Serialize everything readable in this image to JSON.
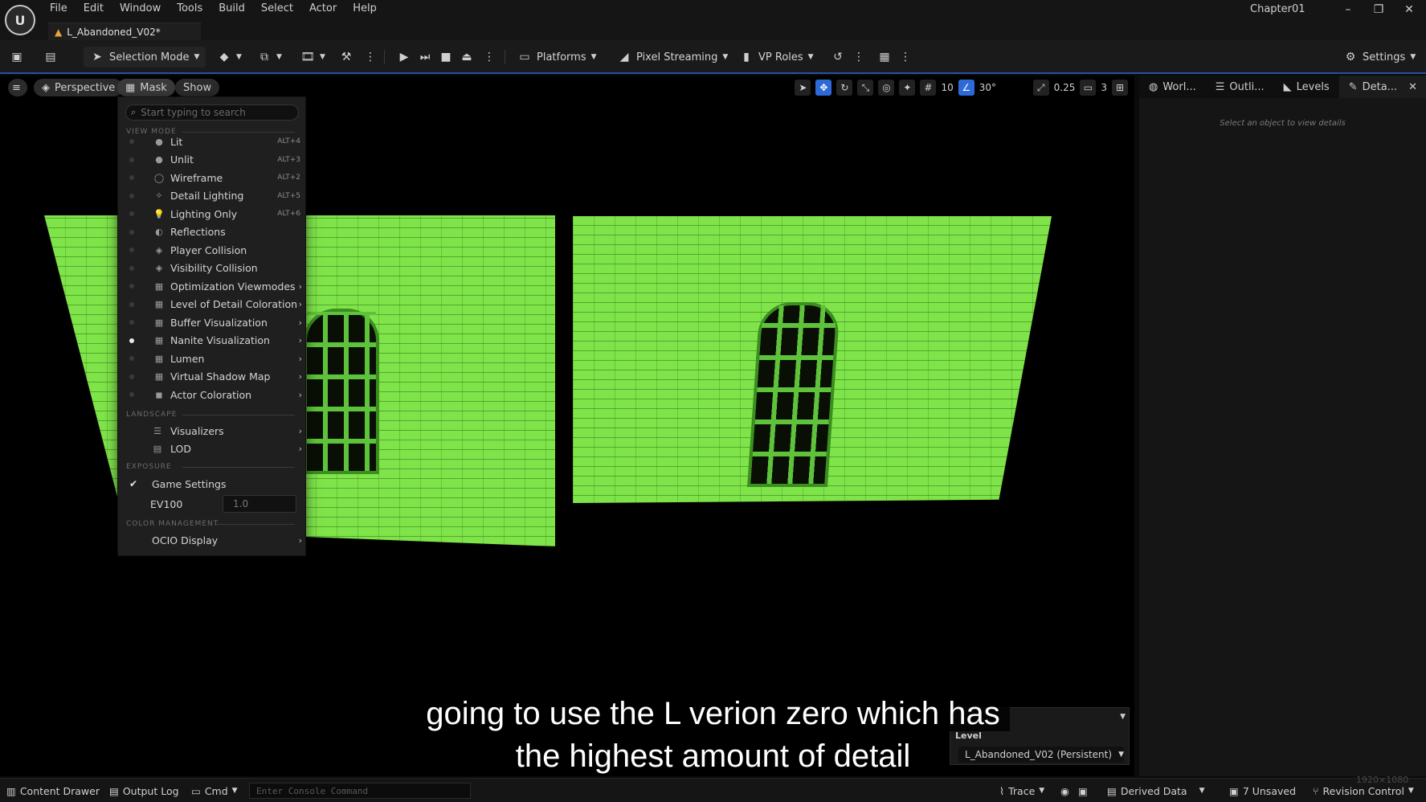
{
  "app": {
    "project_name": "Chapter01",
    "level_tab": "L_Abandoned_V02*"
  },
  "menu_bar": [
    "File",
    "Edit",
    "Window",
    "Tools",
    "Build",
    "Select",
    "Actor",
    "Help"
  ],
  "window_controls": {
    "minimize": "–",
    "restore": "❐",
    "close": "✕"
  },
  "toolbar": {
    "selection_mode": "Selection Mode",
    "platforms": "Platforms",
    "pixel_streaming": "Pixel Streaming",
    "vp_roles": "VP Roles",
    "settings": "Settings"
  },
  "viewport": {
    "perspective": "Perspective",
    "mask": "Mask",
    "show": "Show",
    "grid_snap": "10",
    "rotation_snap": "30°",
    "scale_snap": "0.25",
    "camera_speed": "3"
  },
  "view_mode_menu": {
    "search_placeholder": "Start typing to search",
    "section_view_mode": "VIEW MODE",
    "items": [
      {
        "label": "Lit",
        "shortcut": "ALT+4",
        "icon": "sphere-icon",
        "active": false,
        "submenu": false
      },
      {
        "label": "Unlit",
        "shortcut": "ALT+3",
        "icon": "sphere-icon",
        "active": false,
        "submenu": false
      },
      {
        "label": "Wireframe",
        "shortcut": "ALT+2",
        "icon": "wireframe-icon",
        "active": false,
        "submenu": false
      },
      {
        "label": "Detail Lighting",
        "shortcut": "ALT+5",
        "icon": "detail-lighting-icon",
        "active": false,
        "submenu": false
      },
      {
        "label": "Lighting Only",
        "shortcut": "ALT+6",
        "icon": "bulb-icon",
        "active": false,
        "submenu": false
      },
      {
        "label": "Reflections",
        "shortcut": "",
        "icon": "reflection-icon",
        "active": false,
        "submenu": false
      },
      {
        "label": "Player Collision",
        "shortcut": "",
        "icon": "collision-icon",
        "active": false,
        "submenu": false
      },
      {
        "label": "Visibility Collision",
        "shortcut": "",
        "icon": "collision-icon",
        "active": false,
        "submenu": false
      },
      {
        "label": "Optimization Viewmodes",
        "shortcut": "",
        "icon": "grid-icon",
        "active": false,
        "submenu": true
      },
      {
        "label": "Level of Detail Coloration",
        "shortcut": "",
        "icon": "grid-icon",
        "active": false,
        "submenu": true
      },
      {
        "label": "Buffer Visualization",
        "shortcut": "",
        "icon": "grid-icon",
        "active": false,
        "submenu": true
      },
      {
        "label": "Nanite Visualization",
        "shortcut": "",
        "icon": "grid-icon",
        "active": true,
        "submenu": true
      },
      {
        "label": "Lumen",
        "shortcut": "",
        "icon": "grid-icon",
        "active": false,
        "submenu": true
      },
      {
        "label": "Virtual Shadow Map",
        "shortcut": "",
        "icon": "grid-icon",
        "active": false,
        "submenu": true
      },
      {
        "label": "Actor Coloration",
        "shortcut": "",
        "icon": "cube-icon",
        "active": false,
        "submenu": true
      }
    ],
    "section_landscape": "LANDSCAPE",
    "landscape_items": [
      {
        "label": "Visualizers",
        "icon": "visualizers-icon"
      },
      {
        "label": "LOD",
        "icon": "lod-icon"
      }
    ],
    "section_exposure": "EXPOSURE",
    "game_settings": "Game Settings",
    "ev100_label": "EV100",
    "ev100_value": "1.0",
    "section_color": "COLOR MANAGEMENT",
    "ocio_display": "OCIO Display"
  },
  "right_panel": {
    "tabs": [
      "Worl...",
      "Outli...",
      "Levels",
      "Deta..."
    ],
    "empty_message": "Select an object to view details"
  },
  "level_overlay": {
    "header": "Level",
    "current": "L_Abandoned_V02 (Persistent)"
  },
  "subtitle": {
    "line1": "going to use the L verion zero which has",
    "line2": "the highest amount of detail"
  },
  "status_bar": {
    "content_drawer": "Content Drawer",
    "output_log": "Output Log",
    "cmd": "Cmd",
    "console_placeholder": "Enter Console Command",
    "trace": "Trace",
    "derived_data": "Derived Data",
    "unsaved": "7 Unsaved",
    "revision_control": "Revision Control",
    "resolution": "1920×1080"
  }
}
